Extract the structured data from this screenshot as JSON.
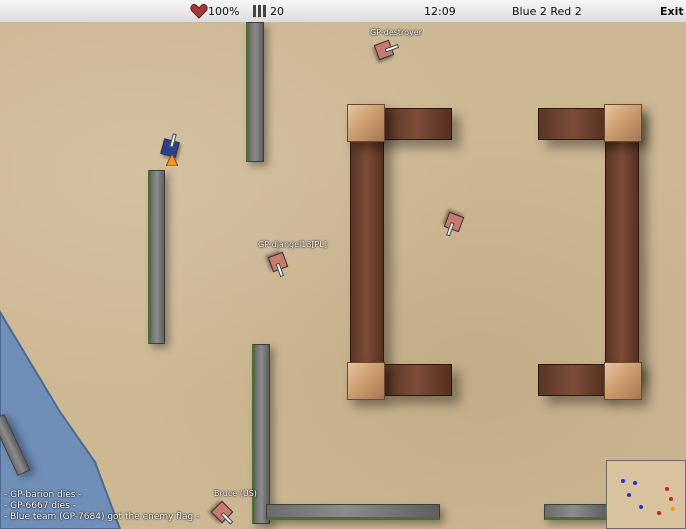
{
  "hud": {
    "health": "100%",
    "ammo": "20",
    "time": "12:09",
    "score": "Blue 2  Red 2",
    "exit_label": "Exit"
  },
  "icons": {
    "health": "heart-icon",
    "ammo": "ammo-icon"
  },
  "colors": {
    "red_team": "#c97b6b",
    "blue_team": "#2d3f8f",
    "water": "#6f8fb8"
  },
  "players": [
    {
      "name": "GP-destroyer",
      "team": "red"
    },
    {
      "name": "GP-djangel13[PL]",
      "team": "red"
    },
    {
      "name": "Bruce (US)",
      "team": "red"
    }
  ],
  "kill_feed": [
    "- GP-barion dies -",
    "- GP-6667 dies -",
    "- Blue team (GP-7684) got the enemy flag -"
  ]
}
